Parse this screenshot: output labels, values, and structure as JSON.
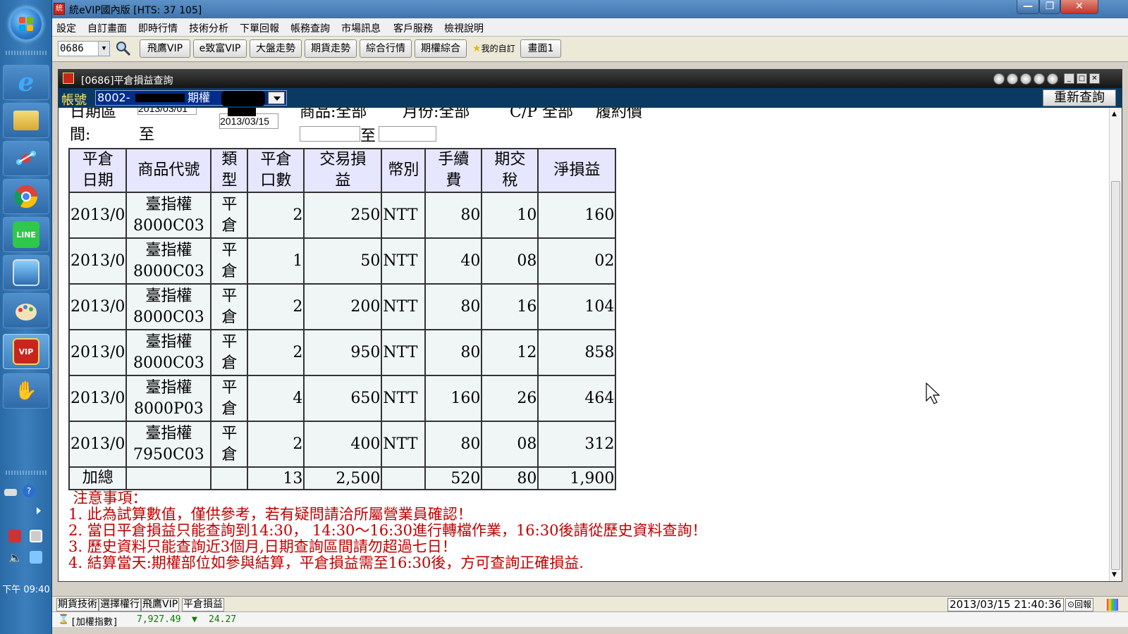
{
  "window": {
    "title": "統eVIP國內版 [HTS: 37 105]",
    "controls": [
      "—",
      "❐",
      "✕"
    ]
  },
  "menu": [
    "設定",
    "自訂畫面",
    "即時行情",
    "技術分析",
    "下單回報",
    "帳務查詢",
    "市場訊息",
    "客戶服務",
    "檢視說明"
  ],
  "toolbar": {
    "code_value": "0686",
    "buttons": [
      "飛鷹VIP",
      "e致富VIP",
      "大盤走勢",
      "期貨走勢",
      "綜合行情",
      "期權綜合"
    ],
    "favorite_label": "我的自訂",
    "screen_label": "畫面1"
  },
  "child": {
    "title": "[0686]平倉損益查詢",
    "account_label": "帳號",
    "account_value": "8002-",
    "account_type": "期權",
    "requery_label": "重新查詢",
    "filter": {
      "date_range_label_top": "日期區",
      "date_range_label_bottom": "間:",
      "date_from": "2013/03/01",
      "to_label": "至",
      "date_to": "2013/03/15",
      "product_label": "商品:全部",
      "month_label": "月份:全部",
      "cp_label": "C/P 全部",
      "strike_label": "履約價",
      "strike_to_label": "至"
    }
  },
  "table": {
    "headers": [
      [
        "平倉",
        "日期"
      ],
      [
        "商品代號"
      ],
      [
        "類",
        "型"
      ],
      [
        "平倉",
        "口數"
      ],
      [
        "交易損",
        "益"
      ],
      [
        "幣別"
      ],
      [
        "手續",
        "費"
      ],
      [
        "期交",
        "稅"
      ],
      [
        "淨損益"
      ]
    ],
    "rows": [
      {
        "date": "2013/0",
        "prod1": "臺指權",
        "prod2": "8000C03",
        "type1": "平",
        "type2": "倉",
        "qty": "2",
        "pnl": "250",
        "cur": "NTT",
        "fee": "80",
        "tax": "10",
        "net": "160"
      },
      {
        "date": "2013/0",
        "prod1": "臺指權",
        "prod2": "8000C03",
        "type1": "平",
        "type2": "倉",
        "qty": "1",
        "pnl": "50",
        "cur": "NTT",
        "fee": "40",
        "tax": "08",
        "net": "02"
      },
      {
        "date": "2013/0",
        "prod1": "臺指權",
        "prod2": "8000C03",
        "type1": "平",
        "type2": "倉",
        "qty": "2",
        "pnl": "200",
        "cur": "NTT",
        "fee": "80",
        "tax": "16",
        "net": "104"
      },
      {
        "date": "2013/0",
        "prod1": "臺指權",
        "prod2": "8000C03",
        "type1": "平",
        "type2": "倉",
        "qty": "2",
        "pnl": "950",
        "cur": "NTT",
        "fee": "80",
        "tax": "12",
        "net": "858"
      },
      {
        "date": "2013/0",
        "prod1": "臺指權",
        "prod2": "8000P03",
        "type1": "平",
        "type2": "倉",
        "qty": "4",
        "pnl": "650",
        "cur": "NTT",
        "fee": "160",
        "tax": "26",
        "net": "464"
      },
      {
        "date": "2013/0",
        "prod1": "臺指權",
        "prod2": "7950C03",
        "type1": "平",
        "type2": "倉",
        "qty": "2",
        "pnl": "400",
        "cur": "NTT",
        "fee": "80",
        "tax": "08",
        "net": "312"
      }
    ],
    "total": {
      "label": "加總",
      "qty": "13",
      "pnl": "2,500",
      "fee": "520",
      "tax": "80",
      "net": "1,900"
    }
  },
  "notes": [
    " 注意事項：",
    "1. 此為試算數值，僅供參考，若有疑問請洽所屬營業員確認！",
    "2. 當日平倉損益只能查詢到14:30， 14:30～16:30進行轉檔作業，16:30後請從歷史資料查詢！",
    "3. 歷史資料只能查詢近3個月,日期查詢區間請勿超過七日！",
    "4. 結算當天:期權部位如參與結算，平倉損益需至16:30後，方可查詢正確損益."
  ],
  "bottom_tabs": [
    "期貨技術",
    "選擇權行",
    "飛鷹VIP",
    "平倉損益"
  ],
  "status": {
    "datetime": "2013/03/15 21:40:36",
    "report_label": "回報",
    "ticker_name": "[加權指數]",
    "ticker_value": "7,927.49",
    "ticker_arrow": "▼",
    "ticker_change": "24.27"
  },
  "taskbar": {
    "clock": "下午 09:40",
    "icons": [
      "windows-start-icon",
      "internet-explorer-icon",
      "folder-icon",
      "network-icon",
      "chrome-icon",
      "line-icon",
      "photo-icon",
      "paint-icon",
      "evip-icon",
      "hand-icon"
    ]
  },
  "colors": {
    "note_red": "#c00000",
    "header_bg": "#e6e6ff",
    "cell_bg": "#f0f5f5",
    "account_label": "#ffe45c",
    "ticker_down": "#008000"
  }
}
